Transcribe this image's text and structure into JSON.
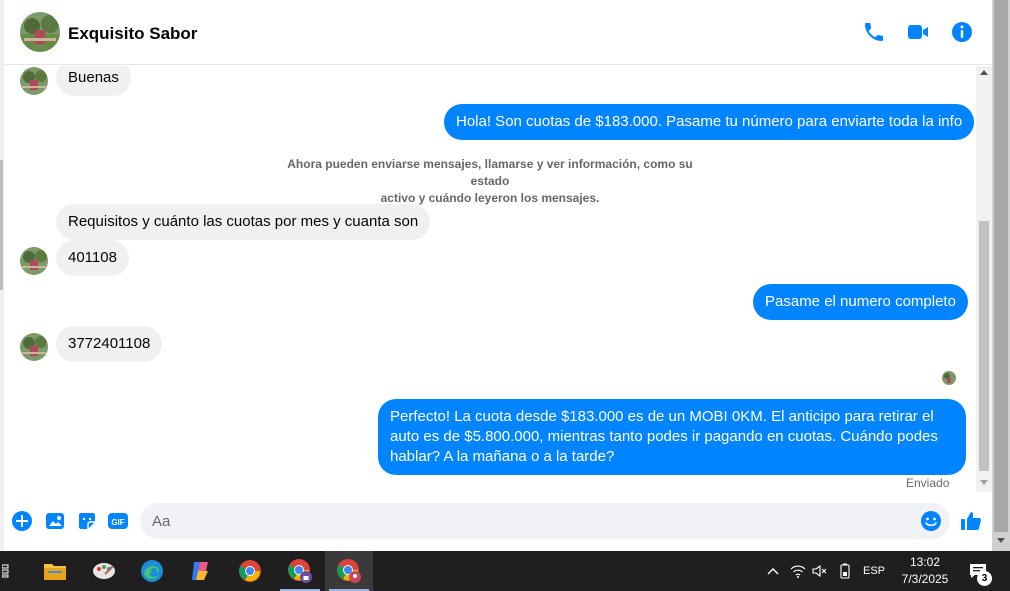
{
  "header": {
    "contact_name": "Exquisito Sabor",
    "call_icon": "phone-icon",
    "video_icon": "video-camera-icon",
    "info_icon": "info-icon"
  },
  "messages": [
    {
      "side": "in",
      "text": "Buenas",
      "avatar": true
    },
    {
      "side": "out",
      "text": "Hola! Son cuotas de $183.000. Pasame tu número para enviarte toda la info"
    },
    {
      "side": "system",
      "line1": "Ahora pueden enviarse mensajes, llamarse y ver información, como su estado",
      "line2": "activo y cuándo leyeron los mensajes."
    },
    {
      "side": "in",
      "text": "Requisitos y cuánto las cuotas por mes y cuanta son",
      "avatar": false
    },
    {
      "side": "in",
      "text": "401108",
      "avatar": true
    },
    {
      "side": "out",
      "text": "Pasame el numero completo"
    },
    {
      "side": "in",
      "text": "3772401108",
      "avatar": true
    },
    {
      "side": "out",
      "text": "Perfecto! La cuota desde $183.000 es de un MOBI 0KM. El anticipo para retirar el auto es de $5.800.000, mientras tanto podes ir pagando en cuotas. Cuándo podes hablar? A la mañana o a la tarde?"
    }
  ],
  "status": {
    "sent_label": "Enviado"
  },
  "composer": {
    "placeholder": "Aa",
    "value": ""
  },
  "taskbar": {
    "apps": [
      "file-explorer",
      "paint",
      "edge",
      "copilot",
      "chrome",
      "chrome-profile-1",
      "chrome-profile-2"
    ],
    "language": "ESP",
    "time": "13:02",
    "date": "7/3/2025",
    "notifications": "3"
  },
  "colors": {
    "accent": "#0084ff",
    "incoming_bubble": "#f0f0f0",
    "taskbar": "#1f1f1f"
  }
}
